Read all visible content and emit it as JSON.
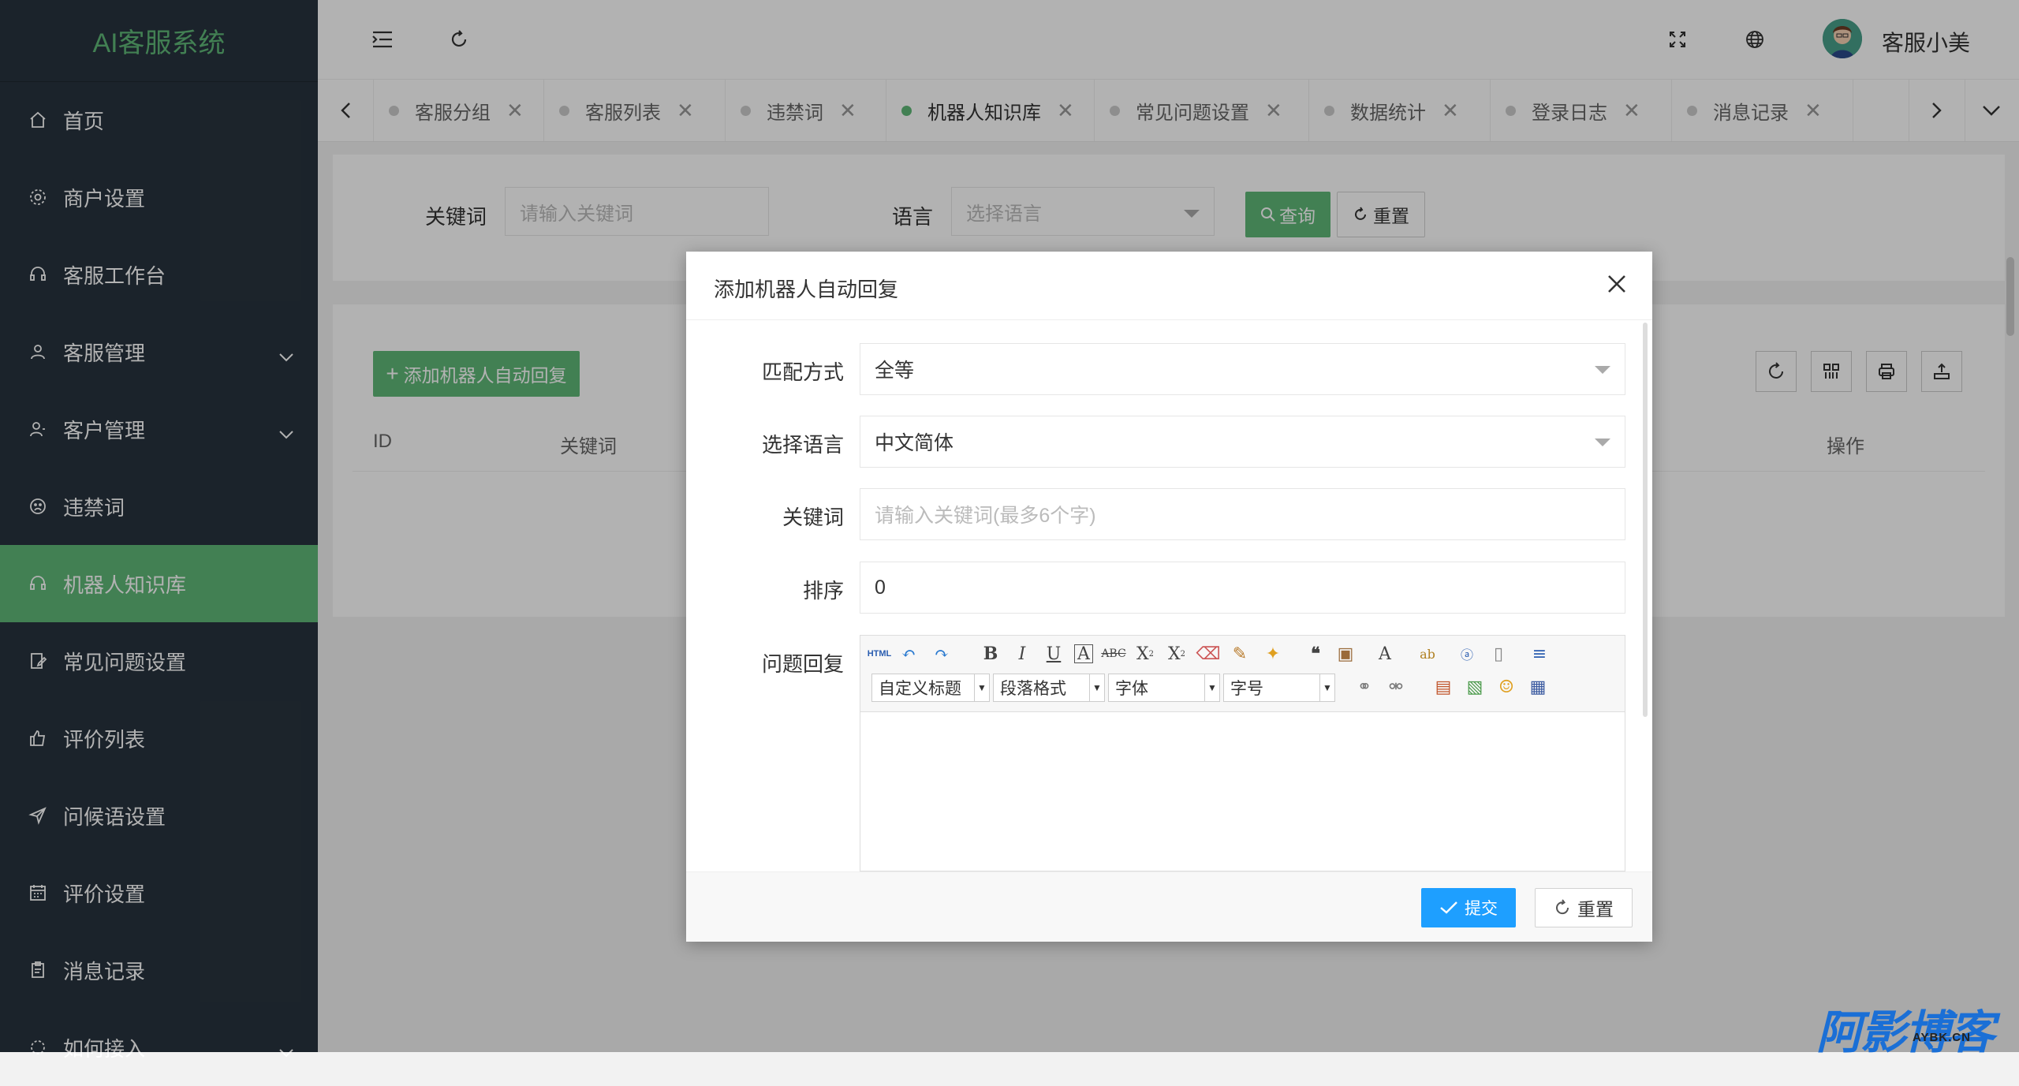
{
  "app": {
    "title": "AI客服系统"
  },
  "sidebar": {
    "items": [
      {
        "label": "首页",
        "icon": "home-icon"
      },
      {
        "label": "商户设置",
        "icon": "gear-icon"
      },
      {
        "label": "客服工作台",
        "icon": "headset-icon"
      },
      {
        "label": "客服管理",
        "icon": "user-icon",
        "expandable": true
      },
      {
        "label": "客户管理",
        "icon": "users-icon",
        "expandable": true
      },
      {
        "label": "违禁词",
        "icon": "sad-face-icon"
      },
      {
        "label": "机器人知识库",
        "icon": "headset-icon",
        "active": true
      },
      {
        "label": "常见问题设置",
        "icon": "edit-icon"
      },
      {
        "label": "评价列表",
        "icon": "thumb-up-icon"
      },
      {
        "label": "问候语设置",
        "icon": "send-icon"
      },
      {
        "label": "评价设置",
        "icon": "calendar-icon"
      },
      {
        "label": "消息记录",
        "icon": "clipboard-icon"
      },
      {
        "label": "如何接入",
        "icon": "link-icon",
        "expandable": true
      }
    ],
    "accent_color": "#5fb878",
    "bg_color": "#28333e"
  },
  "header": {
    "username": "客服小美"
  },
  "tabs": [
    {
      "label": "客服分组"
    },
    {
      "label": "客服列表"
    },
    {
      "label": "违禁词"
    },
    {
      "label": "机器人知识库",
      "active": true
    },
    {
      "label": "常见问题设置"
    },
    {
      "label": "数据统计"
    },
    {
      "label": "登录日志"
    },
    {
      "label": "消息记录"
    }
  ],
  "search": {
    "keyword_label": "关键词",
    "keyword_placeholder": "请输入关键词",
    "language_label": "语言",
    "language_placeholder": "选择语言",
    "query_label": "查询",
    "reset_label": "重置"
  },
  "table": {
    "add_label": "添加机器人自动回复",
    "columns": [
      "ID",
      "关键词",
      "操作"
    ]
  },
  "modal": {
    "title": "添加机器人自动回复",
    "fields": {
      "match_label": "匹配方式",
      "match_value": "全等",
      "lang_label": "选择语言",
      "lang_value": "中文简体",
      "keyword_label": "关键词",
      "keyword_placeholder": "请输入关键词(最多6个字)",
      "sort_label": "排序",
      "sort_value": "0",
      "reply_label": "问题回复"
    },
    "editor": {
      "combo_heading": "自定义标题",
      "combo_paragraph": "段落格式",
      "combo_font": "字体",
      "combo_size": "字号",
      "html_label": "HTML"
    },
    "submit_label": "提交",
    "reset_label": "重置",
    "submit_color": "#1e9fff"
  },
  "watermark": {
    "main": "阿影博客",
    "sub": "AYBK.CN"
  }
}
